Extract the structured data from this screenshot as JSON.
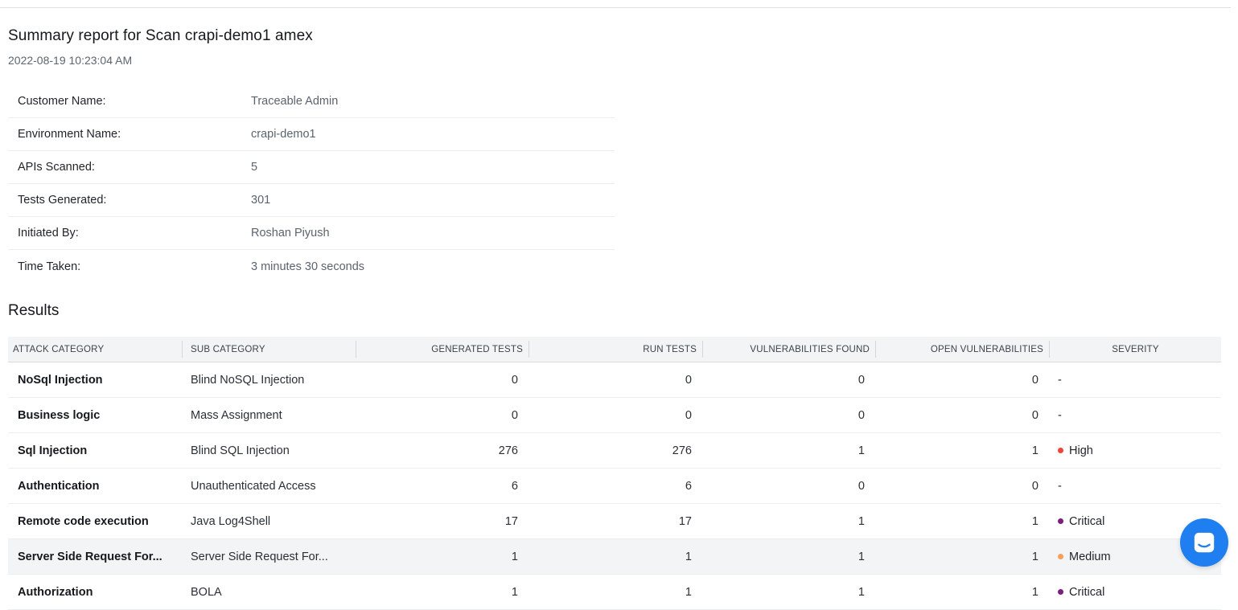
{
  "report": {
    "title": "Summary report for Scan crapi-demo1 amex",
    "date": "2022-08-19 10:23:04 AM"
  },
  "info": [
    {
      "label": "Customer Name:",
      "value": "Traceable Admin"
    },
    {
      "label": "Environment Name:",
      "value": "crapi-demo1"
    },
    {
      "label": "APIs Scanned:",
      "value": "5"
    },
    {
      "label": "Tests Generated:",
      "value": "301"
    },
    {
      "label": "Initiated By:",
      "value": "Roshan Piyush"
    },
    {
      "label": "Time Taken:",
      "value": "3 minutes 30 seconds"
    }
  ],
  "results": {
    "title": "Results",
    "columns": [
      "ATTACK CATEGORY",
      "SUB CATEGORY",
      "GENERATED TESTS",
      "RUN TESTS",
      "VULNERABILITIES FOUND",
      "OPEN VULNERABILITIES",
      "SEVERITY"
    ],
    "rows": [
      {
        "category": "NoSql Injection",
        "sub": "Blind NoSQL Injection",
        "generated": "0",
        "run": "0",
        "found": "0",
        "open": "0",
        "severity": "-",
        "sevColor": ""
      },
      {
        "category": "Business logic",
        "sub": "Mass Assignment",
        "generated": "0",
        "run": "0",
        "found": "0",
        "open": "0",
        "severity": "-",
        "sevColor": ""
      },
      {
        "category": "Sql Injection",
        "sub": "Blind SQL Injection",
        "generated": "276",
        "run": "276",
        "found": "1",
        "open": "1",
        "severity": "High",
        "sevColor": "#f04438"
      },
      {
        "category": "Authentication",
        "sub": "Unauthenticated Access",
        "generated": "6",
        "run": "6",
        "found": "0",
        "open": "0",
        "severity": "-",
        "sevColor": ""
      },
      {
        "category": "Remote code execution",
        "sub": "Java Log4Shell",
        "generated": "17",
        "run": "17",
        "found": "1",
        "open": "1",
        "severity": "Critical",
        "sevColor": "#7b1c7e"
      },
      {
        "category": "Server Side Request For...",
        "sub": "Server Side Request For...",
        "generated": "1",
        "run": "1",
        "found": "1",
        "open": "1",
        "severity": "Medium",
        "sevColor": "#f7a05a"
      },
      {
        "category": "Authorization",
        "sub": "BOLA",
        "generated": "1",
        "run": "1",
        "found": "1",
        "open": "1",
        "severity": "Critical",
        "sevColor": "#7b1c7e"
      }
    ]
  },
  "chat": {
    "icon": "chat-icon",
    "color": "#1f7ff0"
  }
}
